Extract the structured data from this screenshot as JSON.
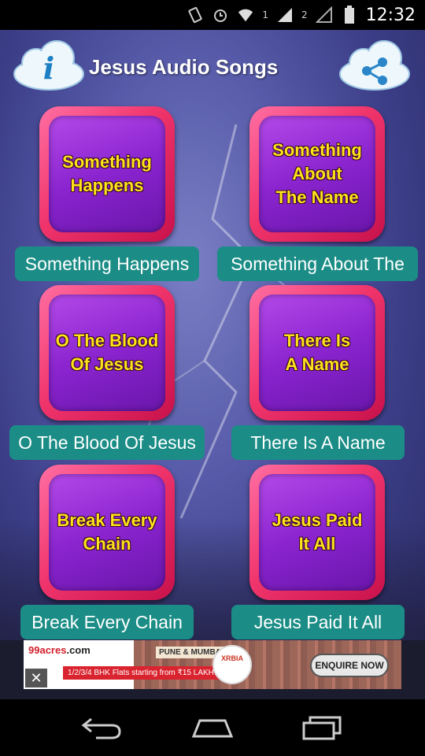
{
  "status_bar": {
    "time": "12:32",
    "sim1_label": "1",
    "sim2_label": "2"
  },
  "header": {
    "title": "Jesus Audio Songs",
    "info_icon": "info-icon",
    "share_icon": "share-icon"
  },
  "songs": [
    {
      "tile_text": "Something\nHappens",
      "label": "Something Happens"
    },
    {
      "tile_text": "Something\nAbout\nThe Name",
      "label": "Something About The"
    },
    {
      "tile_text": "O The Blood\nOf Jesus",
      "label": "O The Blood Of Jesus"
    },
    {
      "tile_text": "There Is\nA Name",
      "label": "There Is A Name"
    },
    {
      "tile_text": "Break Every\nChain",
      "label": "Break Every Chain"
    },
    {
      "tile_text": "Jesus Paid\nIt All",
      "label": "Jesus Paid It All"
    }
  ],
  "ad": {
    "logo_main": "99acres",
    "logo_suffix": ".com",
    "city": "PUNE & MUMBAI",
    "offer": "1/2/3/4 BHK Flats starting from ₹15 LAKH",
    "badge": "XRBIA",
    "cta": "ENQUIRE NOW",
    "close": "✕"
  },
  "colors": {
    "tile_frame": "#f0356c",
    "tile_inner": "#8a24cf",
    "tile_text": "#ffe21a",
    "label_bg": "#1b8d86"
  }
}
